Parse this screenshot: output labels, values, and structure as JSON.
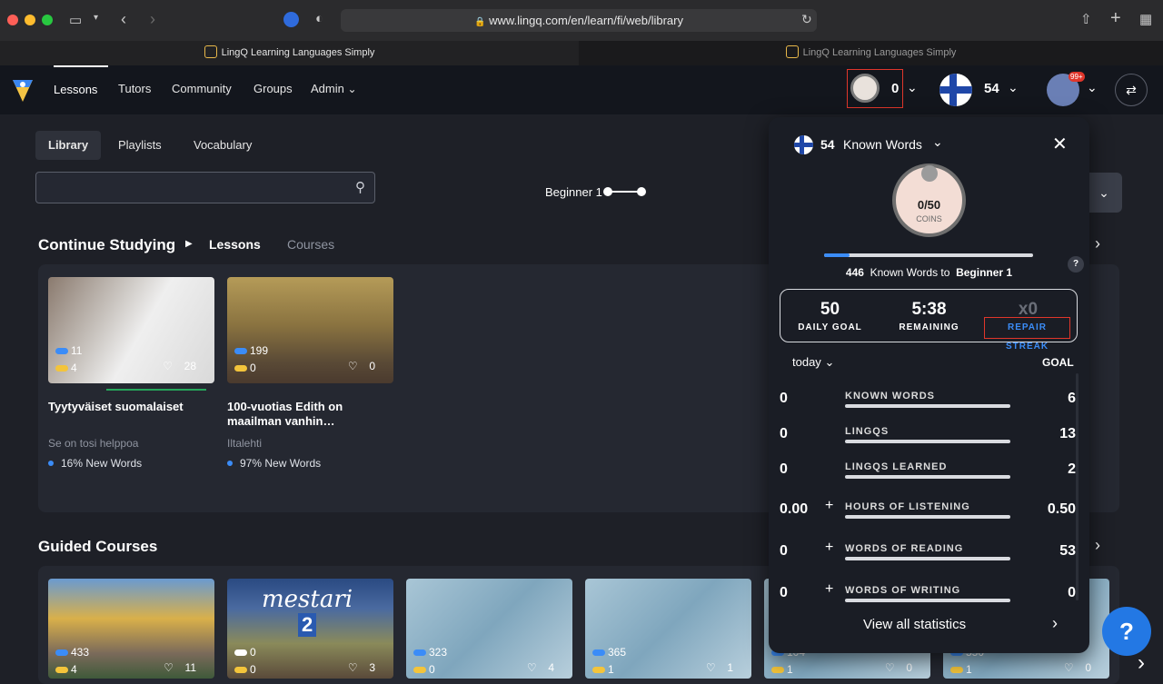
{
  "browser": {
    "url": "www.lingq.com/en/learn/fi/web/library",
    "tabs": [
      {
        "label": "LingQ Learning Languages Simply"
      },
      {
        "label": "LingQ Learning Languages Simply"
      }
    ]
  },
  "nav": {
    "items": [
      "Lessons",
      "Tutors",
      "Community",
      "Groups",
      "Admin"
    ],
    "coins": "0",
    "known_words": "54",
    "avatar_badge": "99+"
  },
  "library": {
    "tabs": [
      "Library",
      "Playlists",
      "Vocabulary"
    ],
    "search_placeholder": "",
    "level_label": "Beginner 1",
    "continue_title": "Continue Studying",
    "continue_tabs": [
      "Lessons",
      "Courses"
    ],
    "guided_title": "Guided Courses"
  },
  "lessons": [
    {
      "title": "Tyytyväiset suomalaiset",
      "source": "Se on tosi helppoa",
      "new_words": "16% New Words",
      "blue": "11",
      "yellow": "4",
      "likes": "28",
      "progress": 0.6
    },
    {
      "title": "100-vuotias Edith on maailman vanhin…",
      "source": "Iltalehti",
      "new_words": "97% New Words",
      "blue": "199",
      "yellow": "0",
      "likes": "0",
      "progress": 0
    }
  ],
  "courses": [
    {
      "blue": "433",
      "yellow": "4",
      "likes": "11"
    },
    {
      "blue": "0",
      "yellow": "0",
      "likes": "3",
      "overlay": "mestari",
      "overlay_num": "2"
    },
    {
      "blue": "323",
      "yellow": "0",
      "likes": "4"
    },
    {
      "blue": "365",
      "yellow": "1",
      "likes": "1"
    },
    {
      "blue": "104",
      "yellow": "1",
      "likes": "0"
    },
    {
      "blue": "550",
      "yellow": "1",
      "likes": "0"
    }
  ],
  "popup": {
    "known_count": "54",
    "known_label": "Known Words",
    "coins_value": "0/50",
    "coins_label": "COINS",
    "progress_fraction": 0.12,
    "to_next_count": "446",
    "to_next_text": "Known Words to",
    "next_level": "Beginner 1",
    "help": "?",
    "daily_goal": "50",
    "daily_goal_label": "DAILY GOAL",
    "remaining": "5:38",
    "remaining_label": "REMAINING",
    "streak": "x0",
    "repair_label": "REPAIR STREAK",
    "period": "today",
    "goal_header": "GOAL",
    "stats": [
      {
        "value": "0",
        "label": "KNOWN WORDS",
        "goal": "6",
        "plus": false
      },
      {
        "value": "0",
        "label": "LINGQS",
        "goal": "13",
        "plus": false
      },
      {
        "value": "0",
        "label": "LINGQS LEARNED",
        "goal": "2",
        "plus": false
      },
      {
        "value": "0.00",
        "label": "HOURS OF LISTENING",
        "goal": "0.50",
        "plus": true
      },
      {
        "value": "0",
        "label": "WORDS OF READING",
        "goal": "53",
        "plus": true
      },
      {
        "value": "0",
        "label": "WORDS OF WRITING",
        "goal": "0",
        "plus": true
      }
    ],
    "view_all": "View all statistics"
  },
  "help_button": "?",
  "colors": {
    "accent_blue": "#3b8cf7",
    "accent_yellow": "#f3c43b",
    "repair_highlight": "#e0362b"
  }
}
